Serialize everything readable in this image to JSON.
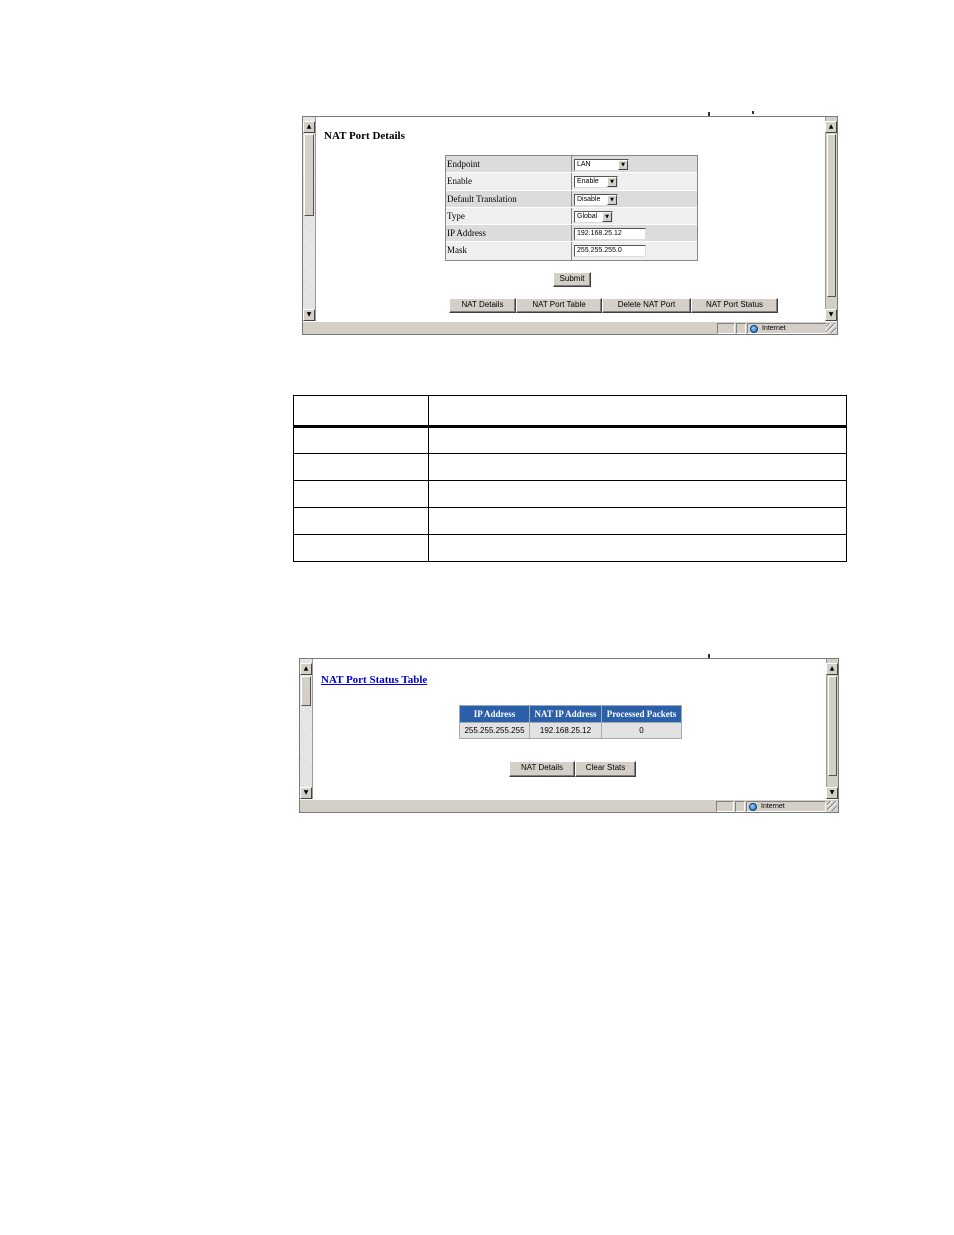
{
  "nat_port_details": {
    "title": "NAT Port Details",
    "fields": [
      {
        "label": "Endpoint",
        "control": "select",
        "value": "LAN"
      },
      {
        "label": "Enable",
        "control": "select",
        "value": "Enable"
      },
      {
        "label": "Default Translation",
        "control": "select",
        "value": "Disable"
      },
      {
        "label": "Type",
        "control": "select",
        "value": "Global"
      },
      {
        "label": "IP Address",
        "control": "text",
        "value": "192.168.25.12"
      },
      {
        "label": "Mask",
        "control": "text",
        "value": "255.255.255.0"
      }
    ],
    "submit_label": "Submit",
    "nav_buttons": [
      "NAT Details",
      "NAT Port Table",
      "Delete NAT Port",
      "NAT Port Status"
    ],
    "status_zone": "Internet"
  },
  "nat_port_status": {
    "title": "NAT Port Status Table",
    "columns": [
      "IP Address",
      "NAT IP Address",
      "Processed Packets"
    ],
    "rows": [
      [
        "255.255.255.255",
        "192.168.25.12",
        "0"
      ]
    ],
    "buttons": [
      "NAT Details",
      "Clear Stats"
    ],
    "status_zone": "Internet"
  }
}
